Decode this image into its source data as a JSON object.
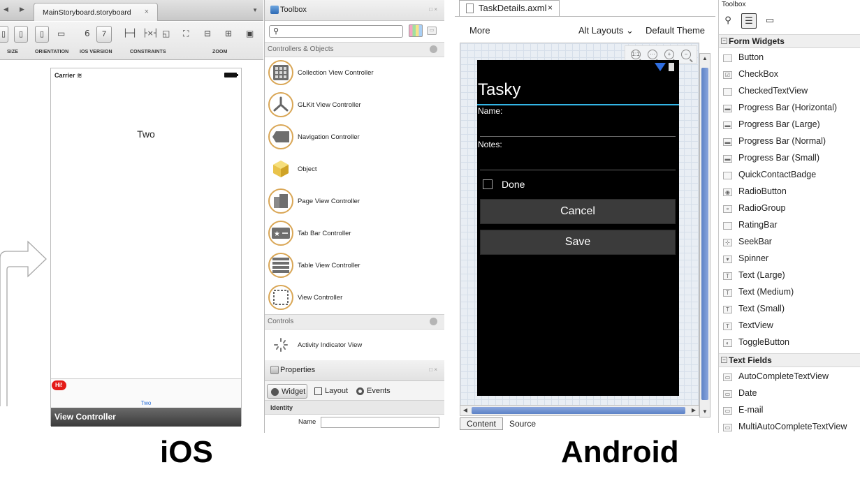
{
  "ios": {
    "tab_title": "MainStoryboard.storyboard",
    "toolbar": {
      "size_label": "SIZE",
      "orientation_label": "ORIENTATION",
      "ios_version_label": "iOS VERSION",
      "constraints_label": "CONSTRAINTS",
      "zoom_label": "ZOOM",
      "version_6": "6",
      "version_7": "7"
    },
    "canvas": {
      "carrier": "Carrier",
      "view_title": "Two",
      "badge": "Hi!",
      "tab_item": "Two",
      "controller_name": "View Controller"
    },
    "toolbox": {
      "title": "Toolbox",
      "section_controllers": "Controllers & Objects",
      "items": [
        "Collection View Controller",
        "GLKit View Controller",
        "Navigation Controller",
        "Object",
        "Page View Controller",
        "Tab Bar Controller",
        "Table View Controller",
        "View Controller"
      ],
      "section_controls": "Controls",
      "controls_items": [
        "Activity Indicator View"
      ]
    },
    "properties": {
      "title": "Properties",
      "tabs": [
        "Widget",
        "Layout",
        "Events"
      ],
      "section_identity": "Identity",
      "name_label": "Name",
      "name_value": ""
    }
  },
  "android": {
    "tab_title": "TaskDetails.axml",
    "topbar": {
      "more": "More",
      "alt_layouts": "Alt Layouts",
      "default_theme": "Default Theme"
    },
    "screen": {
      "title": "Tasky",
      "name_label": "Name:",
      "notes_label": "Notes:",
      "done_label": "Done",
      "cancel_button": "Cancel",
      "save_button": "Save"
    },
    "bottom_tabs": [
      "Content",
      "Source"
    ],
    "toolbox": {
      "title": "Toolbox",
      "section_form_widgets": "Form Widgets",
      "form_widgets": [
        "Button",
        "CheckBox",
        "CheckedTextView",
        "Progress Bar (Horizontal)",
        "Progress Bar (Large)",
        "Progress Bar (Normal)",
        "Progress Bar (Small)",
        "QuickContactBadge",
        "RadioButton",
        "RadioGroup",
        "RatingBar",
        "SeekBar",
        "Spinner",
        "Text (Large)",
        "Text (Medium)",
        "Text (Small)",
        "TextView",
        "ToggleButton"
      ],
      "section_text_fields": "Text Fields",
      "text_fields": [
        "AutoCompleteTextView",
        "Date",
        "E-mail",
        "MultiAutoCompleteTextView"
      ]
    }
  },
  "captions": {
    "ios": "iOS",
    "android": "Android"
  },
  "colors": {
    "android_accent": "#33b5e5",
    "badge_red": "#e41b17",
    "icon_ring": "#d9a655",
    "scroll_blue": "#5d82c6"
  }
}
